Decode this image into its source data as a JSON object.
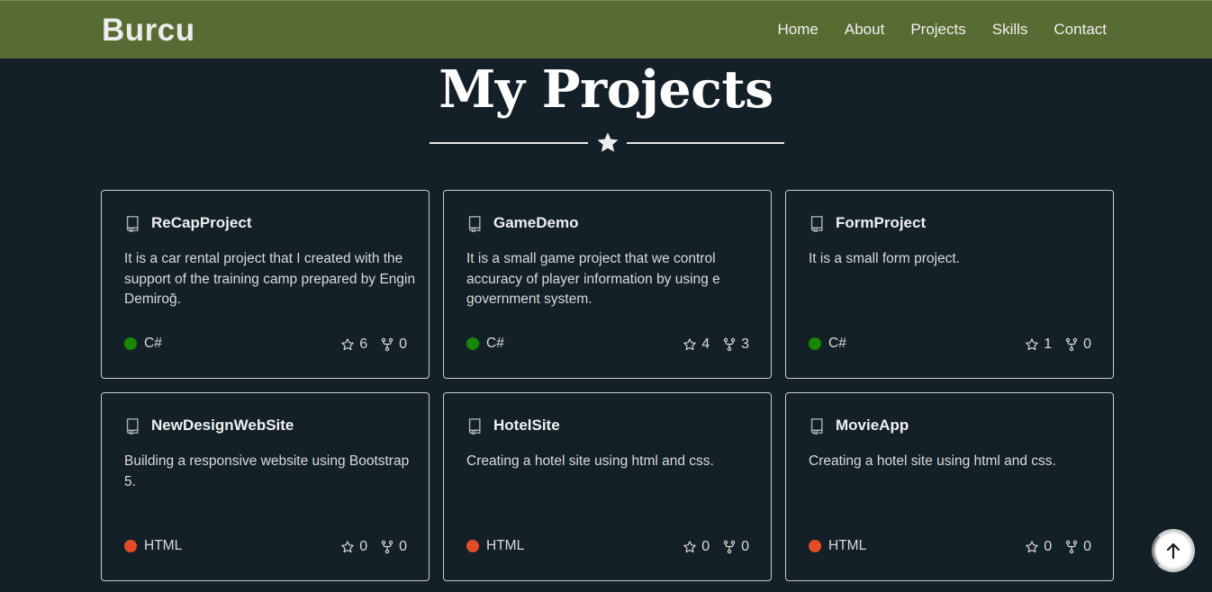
{
  "navbar": {
    "brand": "Burcu",
    "links": [
      "Home",
      "About",
      "Projects",
      "Skills",
      "Contact"
    ],
    "background": "#586b33"
  },
  "section": {
    "title": "My Projects"
  },
  "projects": [
    {
      "name": "ReCapProject",
      "description": "It is a car rental project that I created with the support of the training camp prepared by Engin Demiroğ.",
      "language": "C#",
      "language_color": "#178600",
      "stars": "6",
      "forks": "0"
    },
    {
      "name": "GameDemo",
      "description": "It is a small game project that we control accuracy of player information by using e government system.",
      "language": "C#",
      "language_color": "#178600",
      "stars": "4",
      "forks": "3"
    },
    {
      "name": "FormProject",
      "description": "It is a small form project.",
      "language": "C#",
      "language_color": "#178600",
      "stars": "1",
      "forks": "0"
    },
    {
      "name": "NewDesignWebSite",
      "description": "Building a responsive website using Bootstrap 5.",
      "language": "HTML",
      "language_color": "#e34c26",
      "stars": "0",
      "forks": "0"
    },
    {
      "name": "HotelSite",
      "description": "Creating a hotel site using html and css.",
      "language": "HTML",
      "language_color": "#e34c26",
      "stars": "0",
      "forks": "0"
    },
    {
      "name": "MovieApp",
      "description": "Creating a hotel site using html and css.",
      "language": "HTML",
      "language_color": "#e34c26",
      "stars": "0",
      "forks": "0"
    }
  ],
  "icons": {
    "divider": "star-icon",
    "repo": "repo-icon",
    "stars": "star-outline-icon",
    "forks": "fork-icon",
    "scroll_top": "arrow-up-icon"
  }
}
